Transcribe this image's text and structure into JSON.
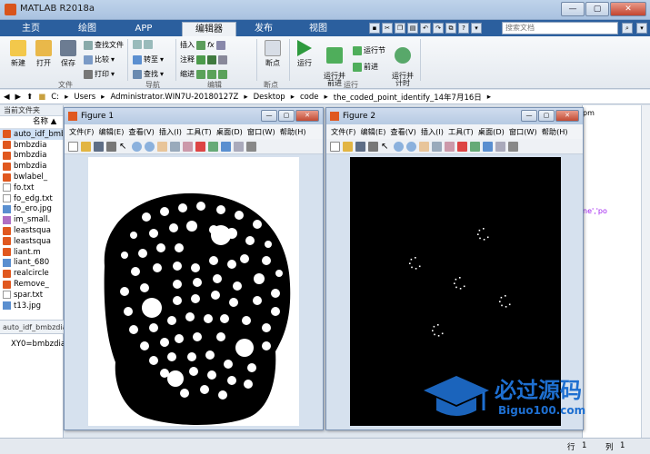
{
  "window": {
    "title": "MATLAB R2018a",
    "min": "—",
    "max": "▢",
    "close": "✕"
  },
  "tabs": [
    {
      "label": "主页"
    },
    {
      "label": "绘图"
    },
    {
      "label": "APP"
    },
    {
      "label": "编辑器"
    },
    {
      "label": "发布"
    },
    {
      "label": "视图"
    }
  ],
  "search": {
    "placeholder": "搜索文档"
  },
  "ribbon": {
    "file_group": {
      "label": "文件",
      "new": "新建",
      "open": "打开",
      "save": "保存",
      "find_files": "查找文件",
      "compare": "比较",
      "print": "打印"
    },
    "nav_group": {
      "label": "导航",
      "goto": "转至",
      "find": "查找"
    },
    "edit_group": {
      "label": "编辑",
      "insert": "插入",
      "comment": "注释",
      "indent": "缩进",
      "fx": "fx"
    },
    "breakpoint_group": {
      "label": "断点",
      "breakpoints": "断点"
    },
    "run_group": {
      "label": "运行",
      "run": "运行",
      "run_advance": "运行并\n前进",
      "run_section": "运行节",
      "advance": "前进",
      "run_time": "运行并\n计时"
    }
  },
  "address": {
    "parts": [
      "C:",
      "Users",
      "Administrator.WIN7U-20180127Z",
      "Desktop",
      "code",
      "the_coded_point_identify_14年7月16日"
    ]
  },
  "current_folder": {
    "title": "当前文件夹",
    "name_header": "名称 ▲",
    "files": [
      {
        "name": "auto_idf_bmbz.m",
        "type": "m",
        "selected": true
      },
      {
        "name": "bmbzdia",
        "type": "m"
      },
      {
        "name": "bmbzdia",
        "type": "m"
      },
      {
        "name": "bmbzdia",
        "type": "m"
      },
      {
        "name": "bwlabel_",
        "type": "m"
      },
      {
        "name": "fo.txt",
        "type": "t"
      },
      {
        "name": "fo_edg.txt",
        "type": "t"
      },
      {
        "name": "fo_ero.jpg",
        "type": "i"
      },
      {
        "name": "im_small.",
        "type": "w"
      },
      {
        "name": "leastsqua",
        "type": "m"
      },
      {
        "name": "leastsqua",
        "type": "m"
      },
      {
        "name": "liant.m",
        "type": "m"
      },
      {
        "name": "liant_680",
        "type": "i"
      },
      {
        "name": "realcircle",
        "type": "m"
      },
      {
        "name": "Remove_",
        "type": "m"
      },
      {
        "name": "spar.txt",
        "type": "t"
      },
      {
        "name": "t13.jpg",
        "type": "i"
      }
    ],
    "details": "auto_idf_bmbzdia"
  },
  "command": {
    "text": "XY0=bmbzdia"
  },
  "editor_snippet": {
    "text1": "pm",
    "text2": "ne','po"
  },
  "status": {
    "row_label": "行",
    "row": "1",
    "col_label": "列",
    "col": "1"
  },
  "figure1": {
    "title": "Figure 1",
    "menus": [
      "文件(F)",
      "编辑(E)",
      "查看(V)",
      "插入(I)",
      "工具(T)",
      "桌面(D)",
      "窗口(W)",
      "帮助(H)"
    ]
  },
  "figure2": {
    "title": "Figure 2",
    "menus": [
      "文件(F)",
      "编辑(E)",
      "查看(V)",
      "插入(I)",
      "工具(T)",
      "桌面(D)",
      "窗口(W)",
      "帮助(H)"
    ]
  },
  "watermark": {
    "brand": "必过源码",
    "url": "Biguo100.com"
  },
  "colors": {
    "accent": "#2b5f9e",
    "matlab": "#e0581f",
    "run": "#2e9a3e",
    "watermark": "#1e6fd0"
  }
}
